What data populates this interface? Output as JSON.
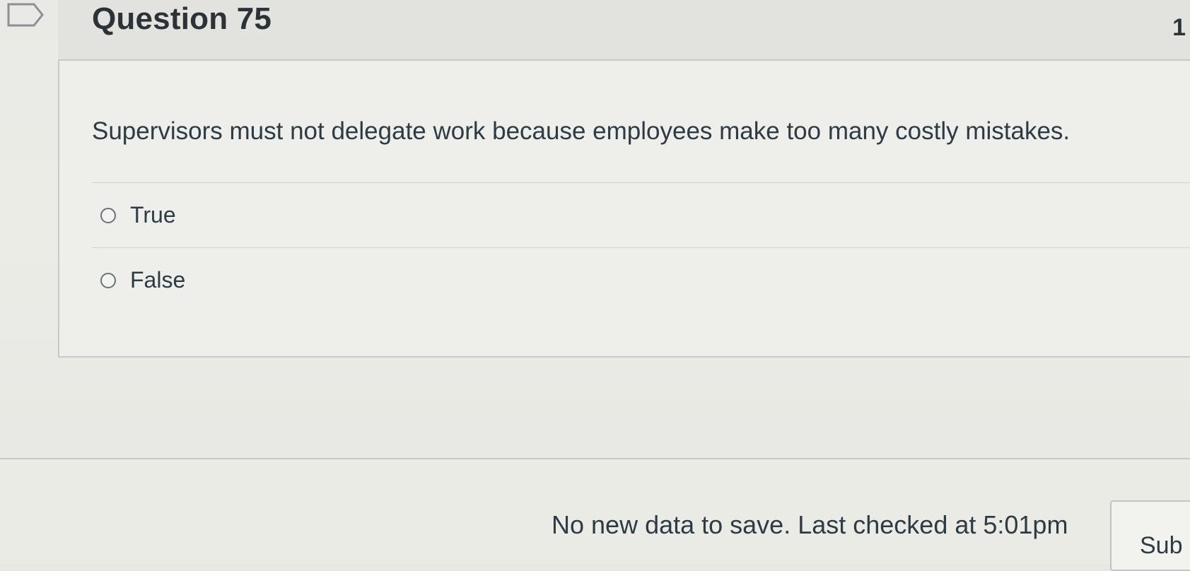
{
  "question": {
    "title": "Question 75",
    "points": "1",
    "text": "Supervisors must not delegate work because employees make too many costly mistakes.",
    "answers": [
      {
        "label": "True"
      },
      {
        "label": "False"
      }
    ]
  },
  "footer": {
    "status": "No new data to save. Last checked at 5:01pm",
    "submit_label": "Sub"
  },
  "icons": {
    "flag": "flag-icon"
  },
  "colors": {
    "background": "#e7e8e3",
    "text": "#2d3b45",
    "border": "#c9cac5"
  }
}
